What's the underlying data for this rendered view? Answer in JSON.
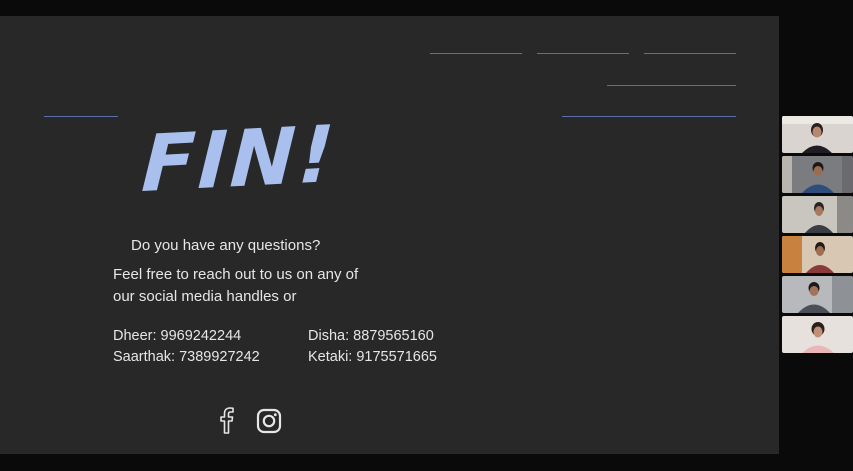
{
  "slide": {
    "title": "FIN!",
    "question": "Do you have any questions?",
    "description_lines": [
      "Feel free to reach out to us on any of",
      "our social media handles or"
    ],
    "contacts": [
      {
        "text": "Dheer: 9969242244"
      },
      {
        "text": "Disha: 8879565160"
      },
      {
        "text": "Saarthak: 7389927242"
      },
      {
        "text": "Ketaki: 9175571665"
      }
    ],
    "social_icons": [
      "facebook-icon",
      "instagram-icon"
    ],
    "accent_color": "#a9c0ee",
    "line_color": "#5b6ea8"
  },
  "participants": [
    {
      "name": "participant-1"
    },
    {
      "name": "participant-2"
    },
    {
      "name": "participant-3"
    },
    {
      "name": "participant-4"
    },
    {
      "name": "participant-5"
    },
    {
      "name": "participant-6"
    }
  ]
}
